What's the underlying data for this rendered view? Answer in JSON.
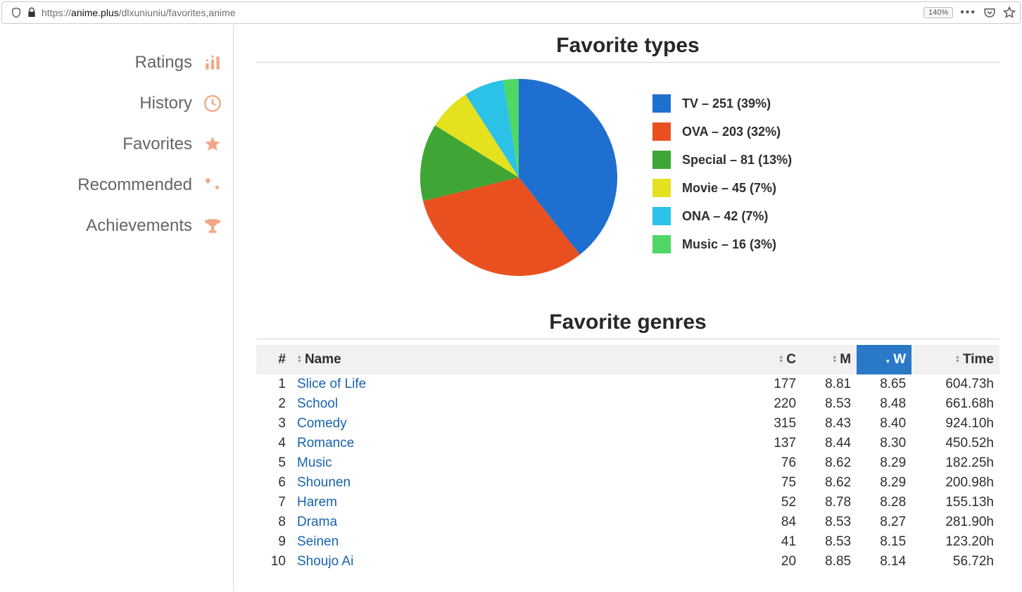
{
  "browser": {
    "url_prefix": "https://",
    "url_host": "anime.plus",
    "url_path": "/dlxuniuniu/favorites,anime",
    "zoom": "140%"
  },
  "sidebar": {
    "items": [
      {
        "label": "Ratings"
      },
      {
        "label": "History"
      },
      {
        "label": "Favorites"
      },
      {
        "label": "Recommended"
      },
      {
        "label": "Achievements"
      }
    ]
  },
  "types_section": {
    "title": "Favorite types"
  },
  "chart_data": {
    "type": "pie",
    "title": "Favorite types",
    "series": [
      {
        "name": "TV",
        "value": 251,
        "pct": 39,
        "color": "#1f6fd0"
      },
      {
        "name": "OVA",
        "value": 203,
        "pct": 32,
        "color": "#e8511f"
      },
      {
        "name": "Special",
        "value": 81,
        "pct": 13,
        "color": "#3fa535"
      },
      {
        "name": "Movie",
        "value": 45,
        "pct": 7,
        "color": "#e4e11f"
      },
      {
        "name": "ONA",
        "value": 42,
        "pct": 7,
        "color": "#2cc1e6"
      },
      {
        "name": "Music",
        "value": 16,
        "pct": 3,
        "color": "#4fd765"
      }
    ]
  },
  "genres_section": {
    "title": "Favorite genres",
    "columns": {
      "rank": "#",
      "name": "Name",
      "c": "C",
      "m": "M",
      "w": "W",
      "time": "Time"
    },
    "rows": [
      {
        "rank": 1,
        "name": "Slice of Life",
        "c": 177,
        "m": "8.81",
        "w": "8.65",
        "time": "604.73h"
      },
      {
        "rank": 2,
        "name": "School",
        "c": 220,
        "m": "8.53",
        "w": "8.48",
        "time": "661.68h"
      },
      {
        "rank": 3,
        "name": "Comedy",
        "c": 315,
        "m": "8.43",
        "w": "8.40",
        "time": "924.10h"
      },
      {
        "rank": 4,
        "name": "Romance",
        "c": 137,
        "m": "8.44",
        "w": "8.30",
        "time": "450.52h"
      },
      {
        "rank": 5,
        "name": "Music",
        "c": 76,
        "m": "8.62",
        "w": "8.29",
        "time": "182.25h"
      },
      {
        "rank": 6,
        "name": "Shounen",
        "c": 75,
        "m": "8.62",
        "w": "8.29",
        "time": "200.98h"
      },
      {
        "rank": 7,
        "name": "Harem",
        "c": 52,
        "m": "8.78",
        "w": "8.28",
        "time": "155.13h"
      },
      {
        "rank": 8,
        "name": "Drama",
        "c": 84,
        "m": "8.53",
        "w": "8.27",
        "time": "281.90h"
      },
      {
        "rank": 9,
        "name": "Seinen",
        "c": 41,
        "m": "8.53",
        "w": "8.15",
        "time": "123.20h"
      },
      {
        "rank": 10,
        "name": "Shoujo Ai",
        "c": 20,
        "m": "8.85",
        "w": "8.14",
        "time": "56.72h"
      }
    ]
  }
}
